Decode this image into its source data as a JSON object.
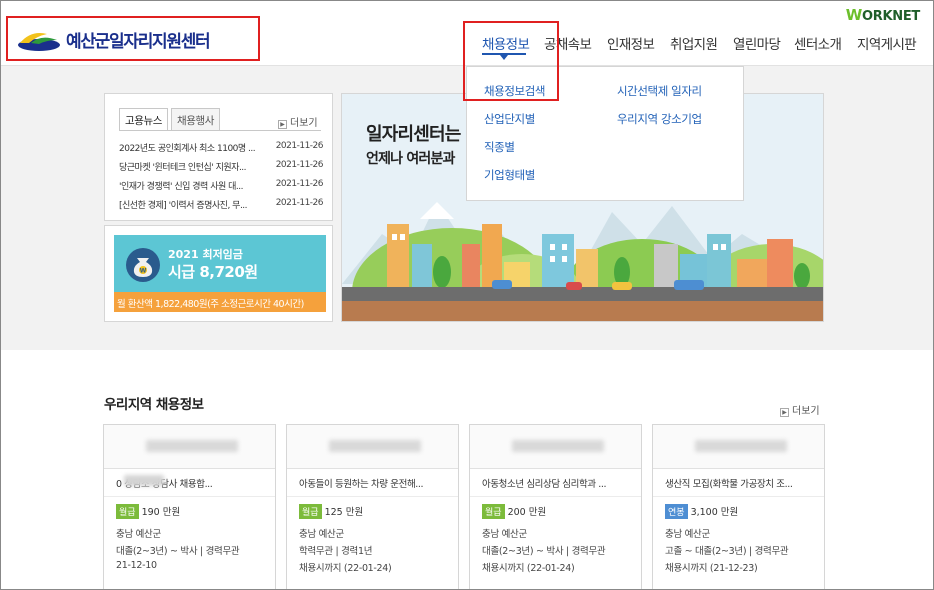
{
  "header": {
    "logo_text": "예산군일자리지원센터",
    "worknet": "ORKNET",
    "nav": [
      "채용정보",
      "공채속보",
      "인재정보",
      "취업지원",
      "열린마당",
      "센터소개",
      "지역게시판"
    ],
    "nav_active": "채용정보"
  },
  "dropdown": {
    "left": [
      "채용정보검색",
      "산업단지별",
      "직종별",
      "기업형태별"
    ],
    "right": [
      "시간선택제 일자리",
      "우리지역 강소기업"
    ]
  },
  "news": {
    "tabs": [
      "고용뉴스",
      "채용행사"
    ],
    "more": "더보기",
    "items": [
      {
        "title": "2022년도 공인회계사 최소 1100명 ...",
        "date": "2021-11-26"
      },
      {
        "title": "당근마켓 '윈터테크 인턴십' 지원자...",
        "date": "2021-11-26"
      },
      {
        "title": "'인재가 경쟁력' 신입 경력 사원 대...",
        "date": "2021-11-26"
      },
      {
        "title": "[신선한 경제] '이력서 증명사진, 무...",
        "date": "2021-11-26"
      }
    ]
  },
  "wage": {
    "year_label": "2021 최저임금",
    "amount": "시급 8,720원",
    "monthly": "월 환산액 1,822,480원(주 소정근로시간 40시간)"
  },
  "banner": {
    "line1": "일자리센터는",
    "line2": "언제나 여러분과"
  },
  "jobs": {
    "title": "우리지역 채용정보",
    "more": "더보기",
    "cards": [
      {
        "title": "0 상담소 상담사 채용합...",
        "pay_type": "월급",
        "pay": "190 만원",
        "region": "충남 예산군",
        "edu": "대졸(2~3년) ~ 박사 | 경력무관",
        "deadline": "21-12-10"
      },
      {
        "title": "아동들이 등원하는 차량 운전해...",
        "pay_type": "월급",
        "pay": "125 만원",
        "region": "충남 예산군",
        "edu": "학력무관 | 경력1년",
        "deadline": "채용시까지 (22-01-24)"
      },
      {
        "title": "아동청소년 심리상담 심리학과 ...",
        "pay_type": "월급",
        "pay": "200 만원",
        "region": "충남 예산군",
        "edu": "대졸(2~3년) ~ 박사 | 경력무관",
        "deadline": "채용시까지 (22-01-24)"
      },
      {
        "title": "생산직 모집(화학물 가공장치 조...",
        "pay_type": "연봉",
        "pay": "3,100 만원",
        "region": "충남 예산군",
        "edu": "고졸 ~ 대졸(2~3년) | 경력무관",
        "deadline": "채용시까지 (21-12-23)"
      }
    ]
  }
}
